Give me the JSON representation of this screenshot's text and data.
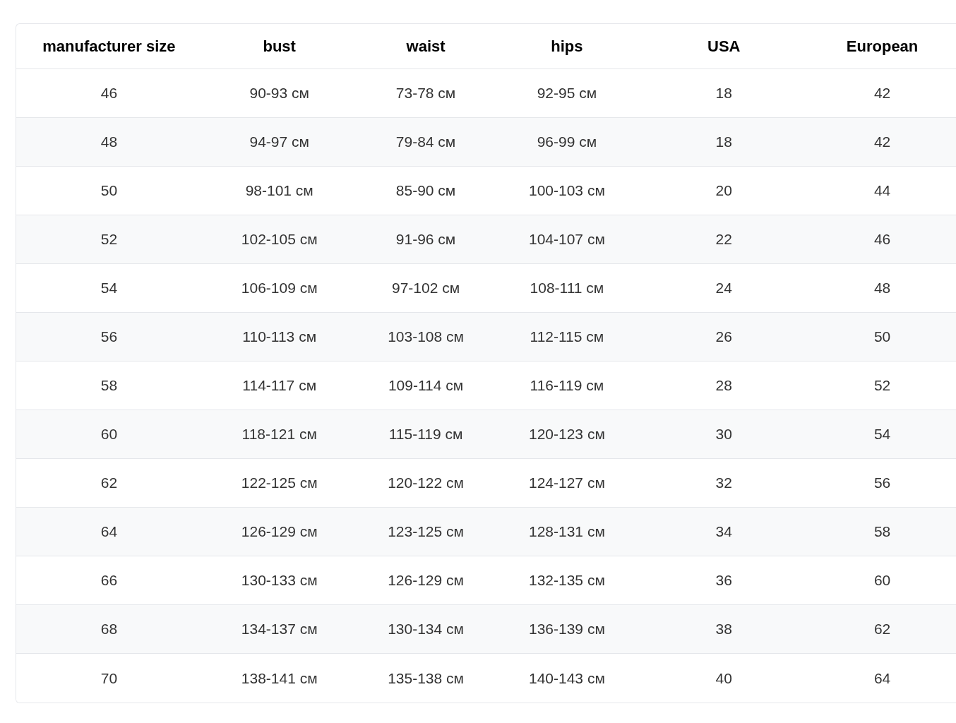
{
  "table": {
    "columns": [
      "manufacturer size",
      "bust",
      "waist",
      "hips",
      "USA",
      "European"
    ],
    "rows": [
      [
        "46",
        "90-93 см",
        "73-78 см",
        "92-95 см",
        "18",
        "42"
      ],
      [
        "48",
        "94-97 см",
        "79-84 см",
        "96-99 см",
        "18",
        "42"
      ],
      [
        "50",
        "98-101 см",
        "85-90 см",
        "100-103 см",
        "20",
        "44"
      ],
      [
        "52",
        "102-105 см",
        "91-96 см",
        "104-107 см",
        "22",
        "46"
      ],
      [
        "54",
        "106-109 см",
        "97-102 см",
        "108-111 см",
        "24",
        "48"
      ],
      [
        "56",
        "110-113 см",
        "103-108 см",
        "112-115 см",
        "26",
        "50"
      ],
      [
        "58",
        "114-117 см",
        "109-114 см",
        "116-119 см",
        "28",
        "52"
      ],
      [
        "60",
        "118-121 см",
        "115-119 см",
        "120-123 см",
        "30",
        "54"
      ],
      [
        "62",
        "122-125 см",
        "120-122 см",
        "124-127 см",
        "32",
        "56"
      ],
      [
        "64",
        "126-129 см",
        "123-125 см",
        "128-131 см",
        "34",
        "58"
      ],
      [
        "66",
        "130-133 см",
        "126-129 см",
        "132-135 см",
        "36",
        "60"
      ],
      [
        "68",
        "134-137 см",
        "130-134 см",
        "136-139 см",
        "38",
        "62"
      ],
      [
        "70",
        "138-141 см",
        "135-138 см",
        "140-143 см",
        "40",
        "64"
      ]
    ]
  }
}
